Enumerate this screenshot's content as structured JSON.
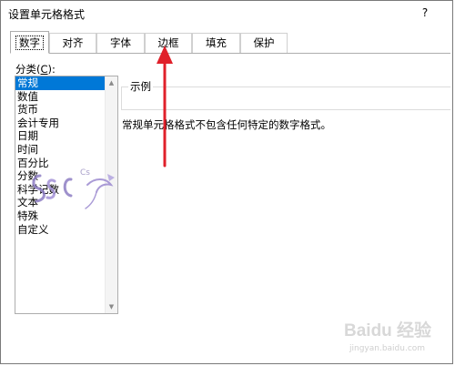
{
  "dialog": {
    "title": "设置单元格格式",
    "help_label": "?"
  },
  "tabs": [
    {
      "label": "数字",
      "active": true
    },
    {
      "label": "对齐",
      "active": false
    },
    {
      "label": "字体",
      "active": false
    },
    {
      "label": "边框",
      "active": false
    },
    {
      "label": "填充",
      "active": false
    },
    {
      "label": "保护",
      "active": false
    }
  ],
  "category": {
    "label_prefix": "分类(",
    "label_hotkey": "C",
    "label_suffix": "):",
    "items": [
      "常规",
      "数值",
      "货币",
      "会计专用",
      "日期",
      "时间",
      "百分比",
      "分数",
      "科学记数",
      "文本",
      "特殊",
      "自定义"
    ],
    "selected": "常规"
  },
  "sample": {
    "legend": "示例",
    "value": ""
  },
  "description": "常规单元格格式不包含任何特定的数字格式。",
  "annotation": {
    "arrow_color": "#e0202a"
  },
  "watermarks": {
    "logo_text": "Cs",
    "baidu_text": "Baidu 经验",
    "baidu_url": "jingyan.baidu.com"
  },
  "colors": {
    "selection": "#0078d7",
    "border": "#adadad"
  }
}
